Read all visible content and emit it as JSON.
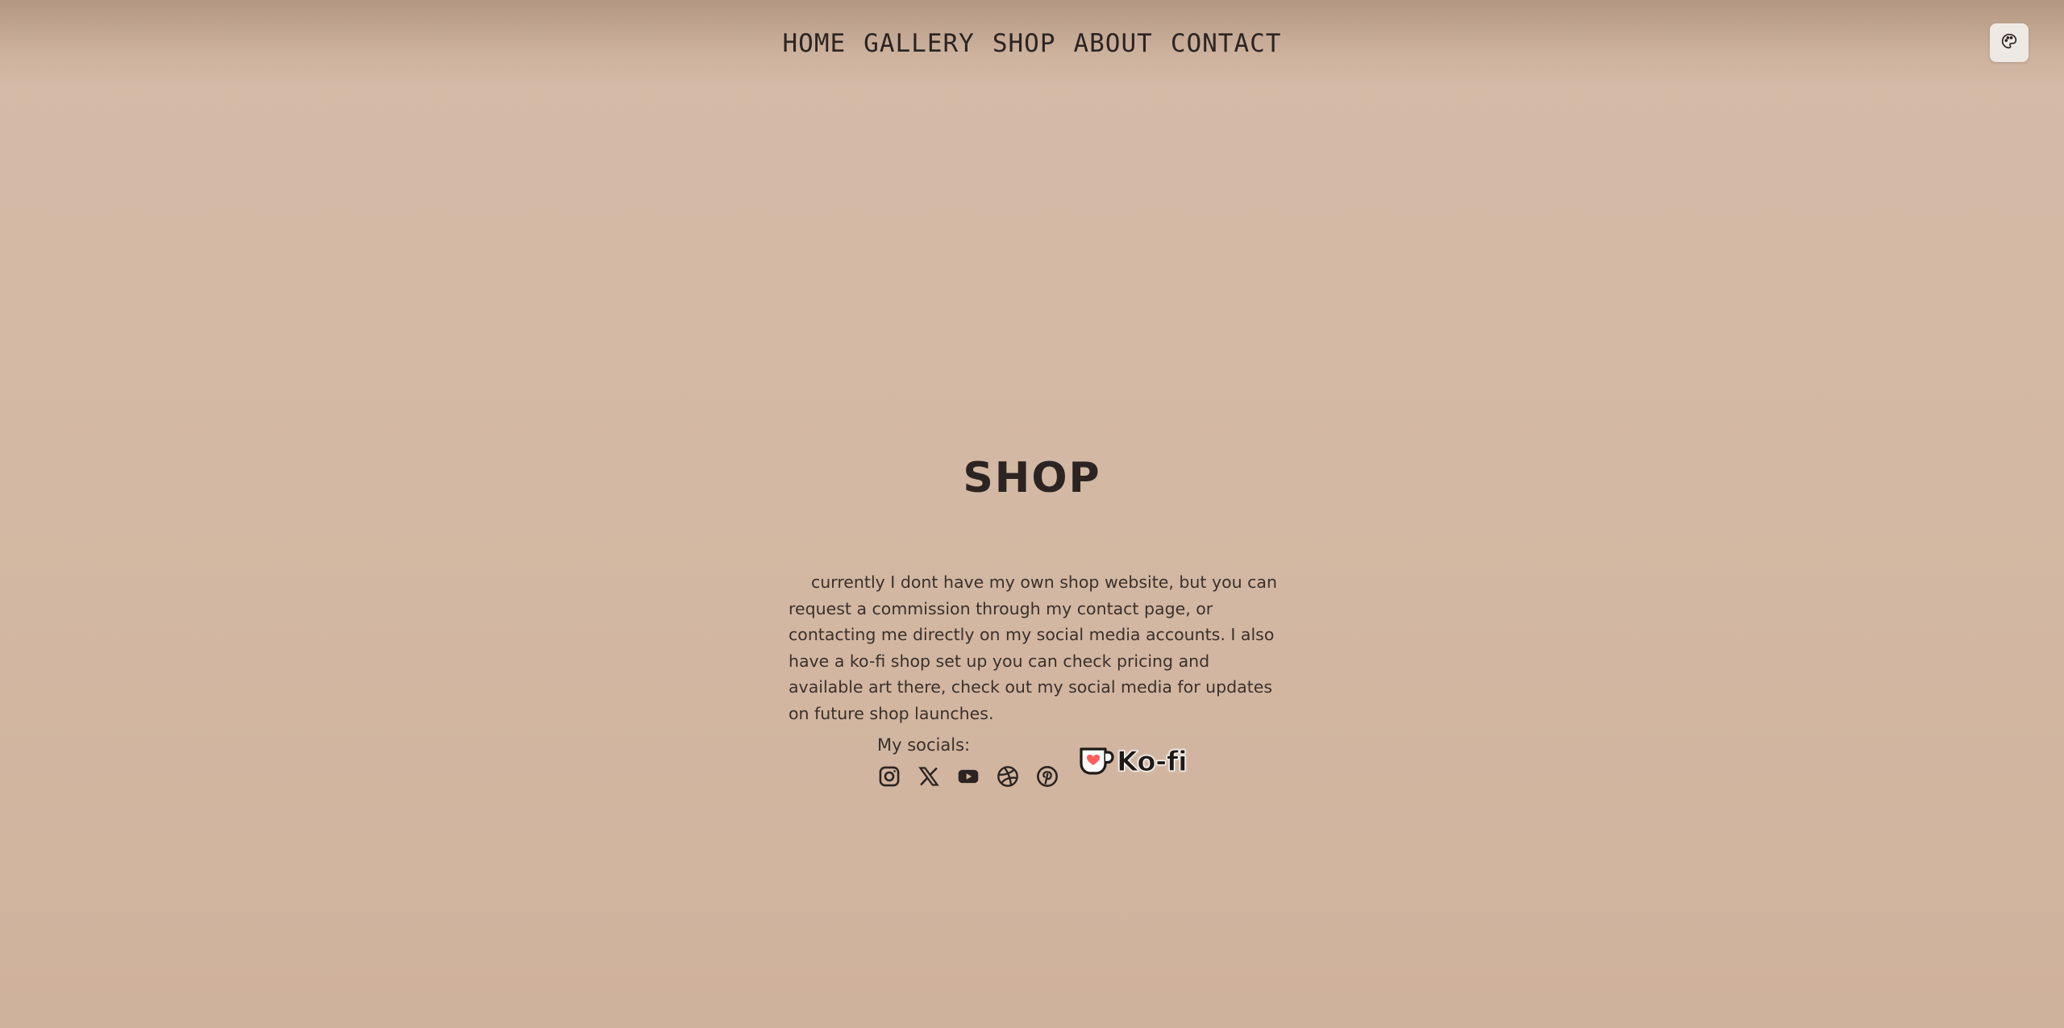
{
  "nav": {
    "items": [
      {
        "label": "HOME"
      },
      {
        "label": "GALLERY"
      },
      {
        "label": "SHOP"
      },
      {
        "label": "ABOUT"
      },
      {
        "label": "CONTACT"
      }
    ]
  },
  "theme_toggle": {
    "icon": "palette-icon"
  },
  "page": {
    "title": "SHOP",
    "description": "currently I dont have my own shop website, but you can request a commission through my contact page, or contacting me directly on my social media accounts. I also have a ko-fi shop set up you can check pricing and available art there, check out my social media for updates on future shop launches."
  },
  "socials": {
    "label": "My socials:",
    "icons": [
      "instagram-icon",
      "x-icon",
      "youtube-icon",
      "dribbble-icon",
      "pinterest-icon"
    ]
  },
  "kofi": {
    "label": "Ko-fi",
    "colors": {
      "cup": "#ffffff",
      "heart": "#ff5e5b",
      "outline": "#1f1a18"
    }
  },
  "colors": {
    "background": "#d3b8a3",
    "text": "#2b2422"
  }
}
